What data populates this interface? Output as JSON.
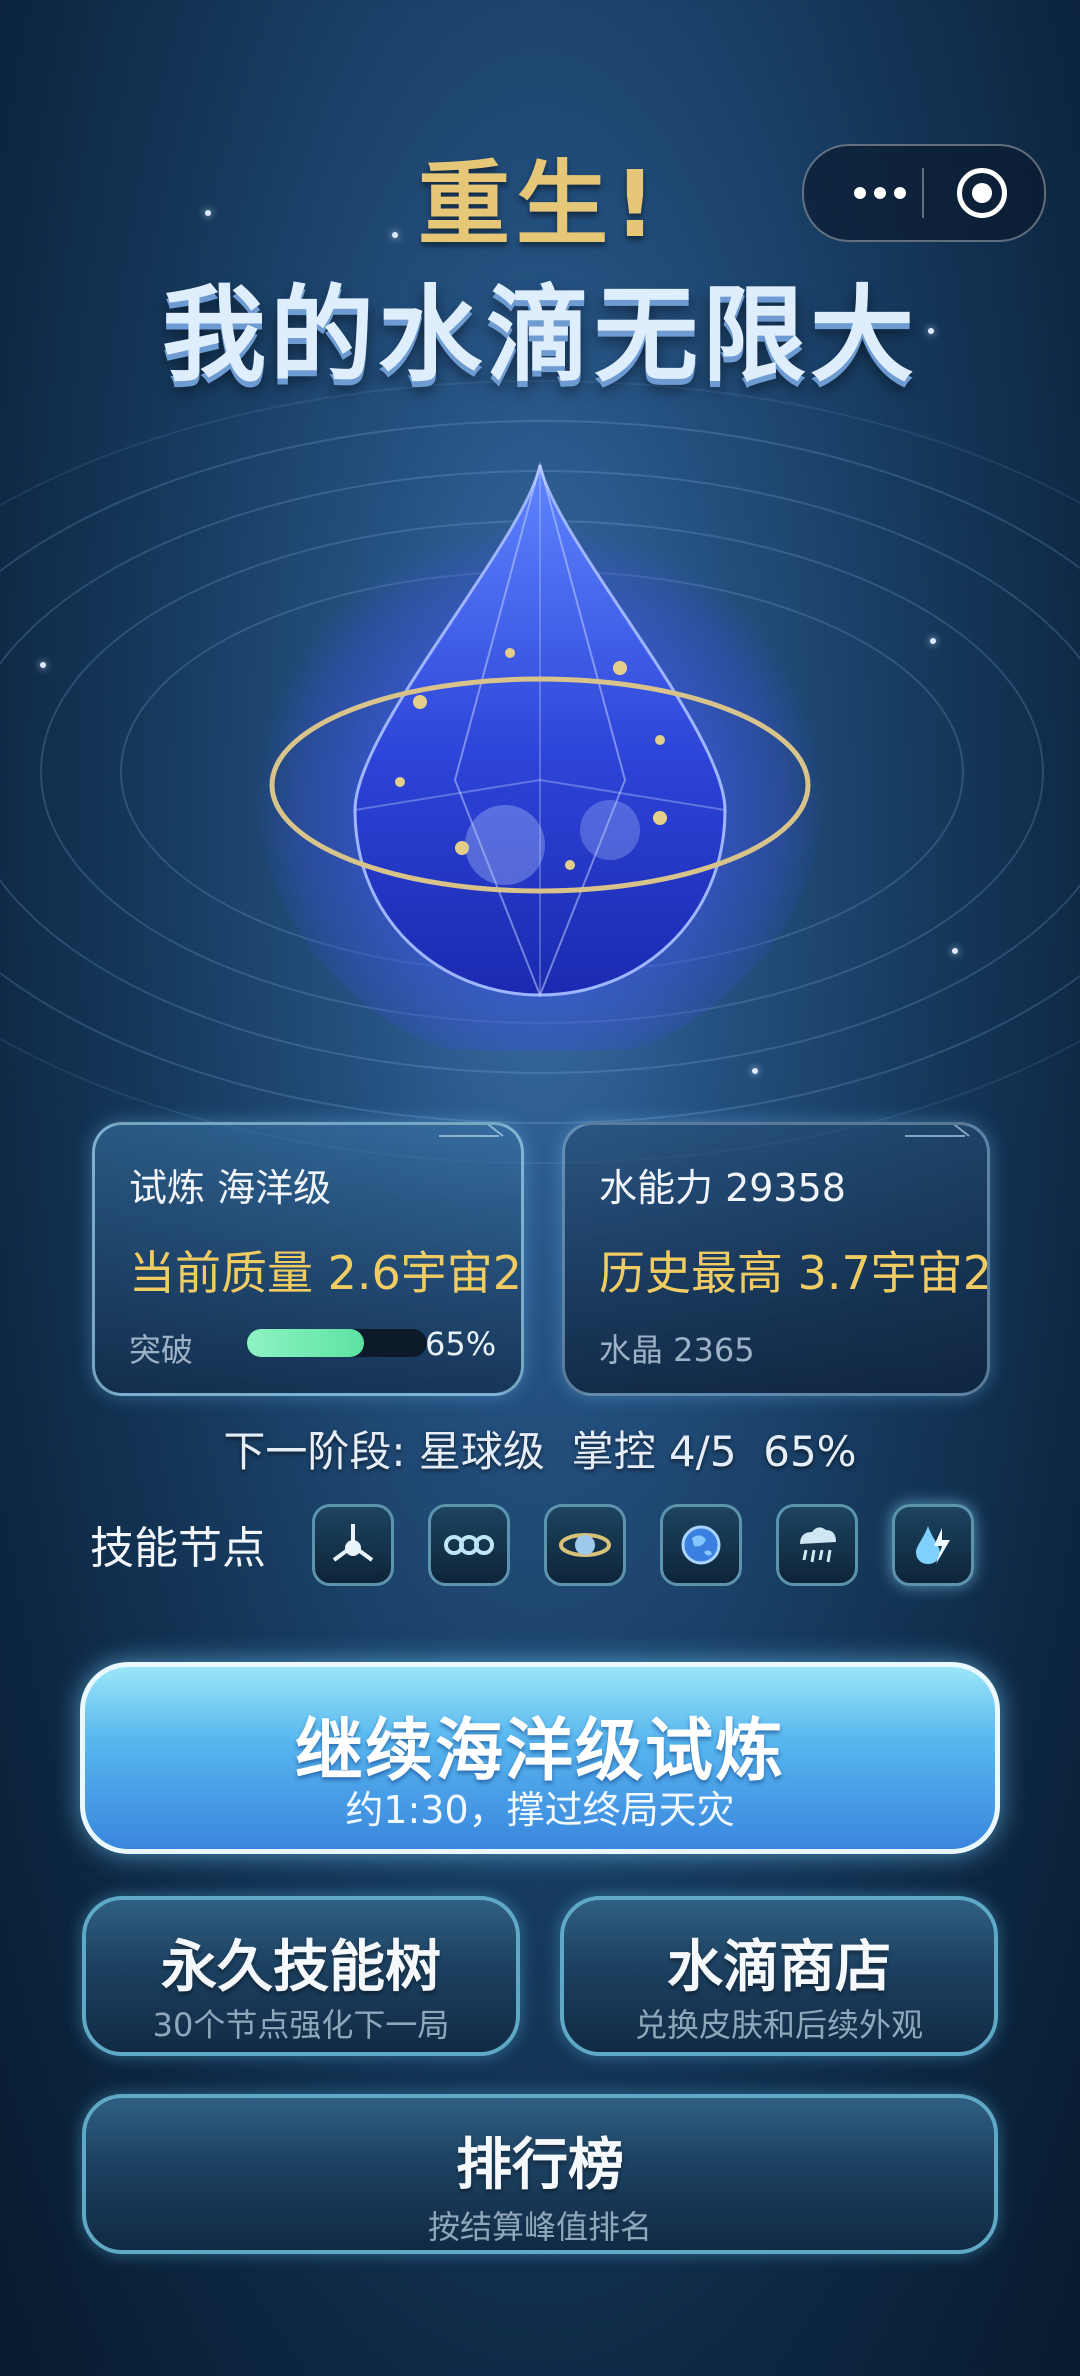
{
  "header": {
    "title_line1": "重生!",
    "title_line2": "我的水滴无限大"
  },
  "capsule": {
    "more_icon": "more-dots-icon",
    "close_icon": "target-circle-icon"
  },
  "stats": {
    "trial_label": "试炼 海洋级",
    "current_mass": "当前质量 2.6宇宙2",
    "breakthrough_label": "突破",
    "breakthrough_progress": 0.65,
    "breakthrough_pct": "65%",
    "water_power": "水能力 29358",
    "history_best": "历史最高 3.7宇宙2",
    "crystal": "水晶 2365"
  },
  "next_stage": "下一阶段: 星球级  掌控 4/5  65%",
  "skills": {
    "label": "技能节点",
    "nodes": [
      {
        "icon": "tri-node-icon"
      },
      {
        "icon": "triple-ring-icon"
      },
      {
        "icon": "planet-ring-icon"
      },
      {
        "icon": "earth-orb-icon"
      },
      {
        "icon": "rain-cloud-icon"
      },
      {
        "icon": "lightning-drop-icon"
      }
    ]
  },
  "buttons": {
    "main_title": "继续海洋级试炼",
    "main_sub": "约1:30，撑过终局天灾",
    "skilltree_title": "永久技能树",
    "skilltree_sub": "30个节点强化下一局",
    "shop_title": "水滴商店",
    "shop_sub": "兑换皮肤和后续外观",
    "rank_title": "排行榜",
    "rank_sub": "按结算峰值排名"
  },
  "colors": {
    "gold": "#f0cc63",
    "progress_green": "#7ef0b8",
    "button_blue": "#58b7ef"
  }
}
